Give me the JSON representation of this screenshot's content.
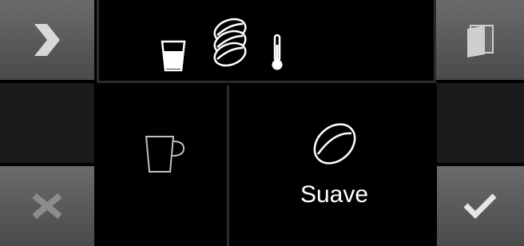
{
  "screen": {
    "next_icon": "chevron-right-icon",
    "door_icon": "door-icon",
    "cancel_icon": "x-icon",
    "confirm_icon": "checkmark-icon"
  },
  "top_bar": {
    "icons": [
      "water-glass-icon",
      "coffee-beans-icon",
      "thermometer-icon"
    ]
  },
  "selection": {
    "cup_icon": "cup-icon",
    "strength_icon": "coffee-bean-icon",
    "strength_label": "Suave"
  },
  "colors": {
    "background": "#000000",
    "button_gray": "#5a5a5a",
    "icon_light": "#ffffff",
    "icon_gray": "#bfbfbf",
    "icon_dim": "#8c8c8c"
  }
}
